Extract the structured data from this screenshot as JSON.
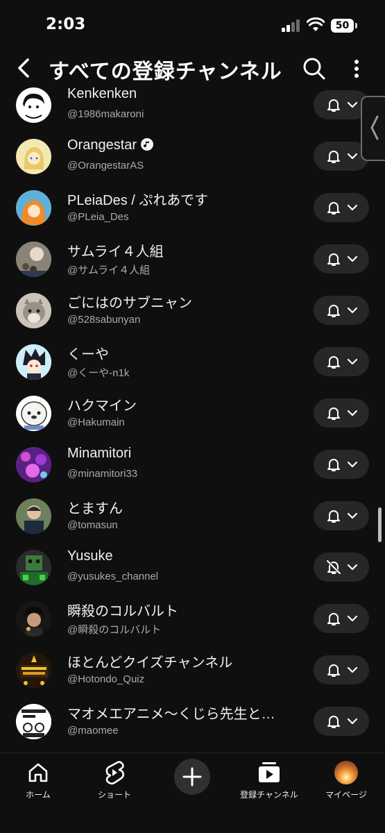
{
  "status_bar": {
    "time": "2:03",
    "battery": "50"
  },
  "header": {
    "title": "すべての登録チャンネル"
  },
  "channels": [
    {
      "name": "Kenkenken",
      "handle": "@1986makaroni",
      "verified": false,
      "notify": "on"
    },
    {
      "name": "Orangestar",
      "handle": "@OrangestarAS",
      "verified": true,
      "notify": "on"
    },
    {
      "name": "PLeiaDes / ぷれあです",
      "handle": "@PLeia_Des",
      "verified": false,
      "notify": "on"
    },
    {
      "name": "サムライ４人組",
      "handle": "@サムライ４人組",
      "verified": false,
      "notify": "on"
    },
    {
      "name": "ごにはのサブニャン",
      "handle": "@528sabunyan",
      "verified": false,
      "notify": "on"
    },
    {
      "name": "くーや",
      "handle": "@くーや-n1k",
      "verified": false,
      "notify": "on"
    },
    {
      "name": "ハクマイン",
      "handle": "@Hakumain",
      "verified": false,
      "notify": "on"
    },
    {
      "name": "Minamitori",
      "handle": "@minamitori33",
      "verified": false,
      "notify": "on"
    },
    {
      "name": "とますん",
      "handle": "@tomasun",
      "verified": false,
      "notify": "on"
    },
    {
      "name": "Yusuke",
      "handle": "@yusukes_channel",
      "verified": false,
      "notify": "off"
    },
    {
      "name": "瞬殺のコルバルト",
      "handle": "@瞬殺のコルバルト",
      "verified": false,
      "notify": "on"
    },
    {
      "name": "ほとんどクイズチャンネル",
      "handle": "@Hotondo_Quiz",
      "verified": false,
      "notify": "on"
    },
    {
      "name": "マオメエアニメ〜くじら先生と…",
      "handle": "@maomee",
      "verified": false,
      "notify": "on"
    }
  ],
  "bottom_nav": {
    "home": "ホーム",
    "shorts": "ショート",
    "subscriptions": "登録チャンネル",
    "mypage": "マイページ"
  },
  "colors": {
    "background": "#0f0f0f",
    "chip": "#272727",
    "secondary_text": "#aaaaaa"
  }
}
